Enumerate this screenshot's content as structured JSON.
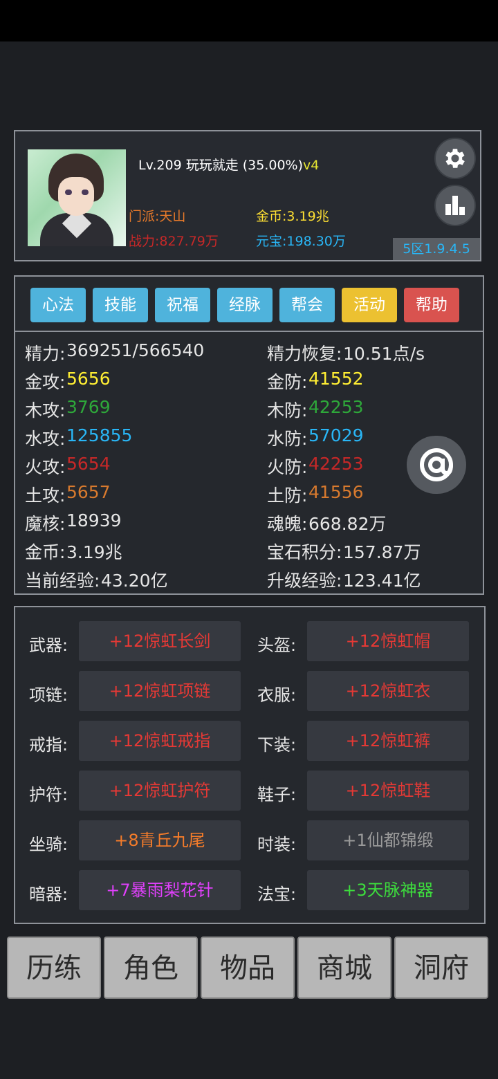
{
  "header": {
    "title_main": "Lv.209 玩玩就走 (35.00%)",
    "title_version": "v4",
    "sect": "门派:天山",
    "power": "战力:827.79万",
    "gold": "金币:3.19兆",
    "ingot": "元宝:198.30万",
    "server": "5区1.9.4.5"
  },
  "tabs": [
    "心法",
    "技能",
    "祝福",
    "经脉",
    "帮会",
    "活动",
    "帮助"
  ],
  "stats": {
    "left": [
      {
        "label": "精力:",
        "value": "369251/566540",
        "color": "#e6e6e6"
      },
      {
        "label": "金攻:",
        "value": "5656",
        "color": "#ffee33"
      },
      {
        "label": "木攻:",
        "value": "3769",
        "color": "#2ea83a"
      },
      {
        "label": "水攻:",
        "value": "125855",
        "color": "#29b6f6"
      },
      {
        "label": "火攻:",
        "value": "5654",
        "color": "#c62828"
      },
      {
        "label": "土攻:",
        "value": "5657",
        "color": "#d87a2e"
      },
      {
        "label": "魔核:",
        "value": "18939",
        "color": "#e6e6e6"
      },
      {
        "label": "金币:",
        "value": "3.19兆",
        "color": "#e6e6e6"
      },
      {
        "label": "当前经验:",
        "value": "43.20亿",
        "color": "#e6e6e6"
      }
    ],
    "right": [
      {
        "label": "精力恢复:",
        "value": "10.51点/s",
        "color": "#e6e6e6"
      },
      {
        "label": "金防:",
        "value": "41552",
        "color": "#ffee33"
      },
      {
        "label": "木防:",
        "value": "42253",
        "color": "#2ea83a"
      },
      {
        "label": "水防:",
        "value": "57029",
        "color": "#29b6f6"
      },
      {
        "label": "火防:",
        "value": "42253",
        "color": "#c62828"
      },
      {
        "label": "土防:",
        "value": "41556",
        "color": "#d87a2e"
      },
      {
        "label": "魂魄:",
        "value": "668.82万",
        "color": "#e6e6e6"
      },
      {
        "label": "宝石积分:",
        "value": "157.87万",
        "color": "#e6e6e6"
      },
      {
        "label": "升级经验:",
        "value": "123.41亿",
        "color": "#e6e6e6"
      }
    ]
  },
  "equipment": [
    {
      "label": "武器:",
      "item": "+12惊虹长剑",
      "color": "#e53935"
    },
    {
      "label": "头盔:",
      "item": "+12惊虹帽",
      "color": "#e53935"
    },
    {
      "label": "项链:",
      "item": "+12惊虹项链",
      "color": "#e53935"
    },
    {
      "label": "衣服:",
      "item": "+12惊虹衣",
      "color": "#e53935"
    },
    {
      "label": "戒指:",
      "item": "+12惊虹戒指",
      "color": "#e53935"
    },
    {
      "label": "下装:",
      "item": "+12惊虹裤",
      "color": "#e53935"
    },
    {
      "label": "护符:",
      "item": "+12惊虹护符",
      "color": "#e53935"
    },
    {
      "label": "鞋子:",
      "item": "+12惊虹鞋",
      "color": "#e53935"
    },
    {
      "label": "坐骑:",
      "item": "+8青丘九尾",
      "color": "#f57c2a"
    },
    {
      "label": "时装:",
      "item": "+1仙都锦缎",
      "color": "#9a9a9a"
    },
    {
      "label": "暗器:",
      "item": "+7暴雨梨花针",
      "color": "#e040fb"
    },
    {
      "label": "法宝:",
      "item": "+3天脉神器",
      "color": "#3ddc3d"
    }
  ],
  "nav": [
    "历练",
    "角色",
    "物品",
    "商城",
    "洞府"
  ],
  "icons": {
    "settings": "gear-icon",
    "rank": "bar-chart-icon",
    "at": "at-icon"
  }
}
